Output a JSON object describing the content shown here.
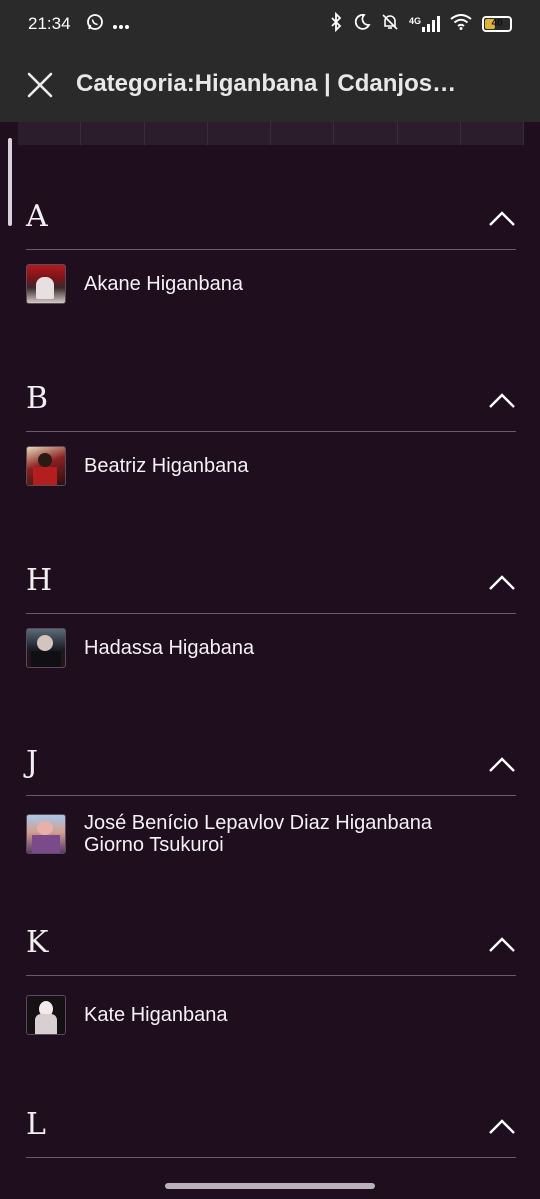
{
  "status_bar": {
    "time": "21:34",
    "left_icons": [
      "whatsapp-icon",
      "more-dots-icon"
    ],
    "right_icons": [
      "bluetooth-icon",
      "moon-icon",
      "bell-off-icon",
      "signal-4g-icon",
      "wifi-icon",
      "battery-icon"
    ],
    "network_label": "4G",
    "battery_level": "40"
  },
  "header": {
    "title": "Categoria:Higanbana | Cdanjos…",
    "close_icon": "close-icon"
  },
  "sections": [
    {
      "letter": "A",
      "members": [
        {
          "name": "Akane Higanbana"
        }
      ]
    },
    {
      "letter": "B",
      "members": [
        {
          "name": "Beatriz Higanbana"
        }
      ]
    },
    {
      "letter": "H",
      "members": [
        {
          "name": "Hadassa Higabana"
        }
      ]
    },
    {
      "letter": "J",
      "members": [
        {
          "name_line1": "José Benício Lepavlov Diaz Higanbana",
          "name_line2": "Giorno Tsukuroi"
        }
      ]
    },
    {
      "letter": "K",
      "members": [
        {
          "name": "Kate Higanbana"
        }
      ]
    },
    {
      "letter": "L",
      "members": []
    }
  ],
  "colors": {
    "background": "#1e0e1e",
    "bar": "#2a2a2a",
    "divider": "#6a5a6a"
  }
}
